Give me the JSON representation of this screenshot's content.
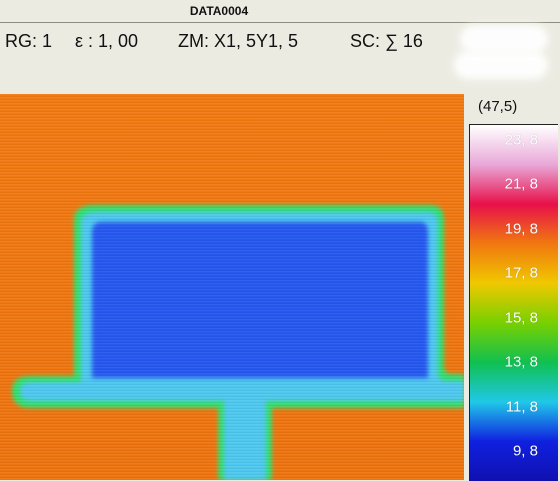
{
  "window": {
    "title": "DATA0004"
  },
  "status": {
    "range": "RG: 1",
    "emissivity": "ε : 1, 00",
    "zoom": "ZM: X1, 5Y1, 5",
    "sum": "SC: ∑ 16"
  },
  "thermal_image": {
    "background_color": "#f07810",
    "shape_edge_color": "#50c8f0",
    "shape_core_color": "#2858f0",
    "shape_rim_color": "#30e070"
  },
  "scale": {
    "header": "(47,5)",
    "labels": [
      {
        "text": "23, 8",
        "color": "#e8a8d8"
      },
      {
        "text": "21, 8",
        "color": "#e8104a"
      },
      {
        "text": "19, 8",
        "color": "#f07810"
      },
      {
        "text": "17, 8",
        "color": "#f0c800"
      },
      {
        "text": "15, 8",
        "color": "#78d000"
      },
      {
        "text": "13, 8",
        "color": "#10c050"
      },
      {
        "text": "11, 8",
        "color": "#20c8e8"
      },
      {
        "text": "9, 8",
        "color": "#1020e0"
      }
    ]
  }
}
